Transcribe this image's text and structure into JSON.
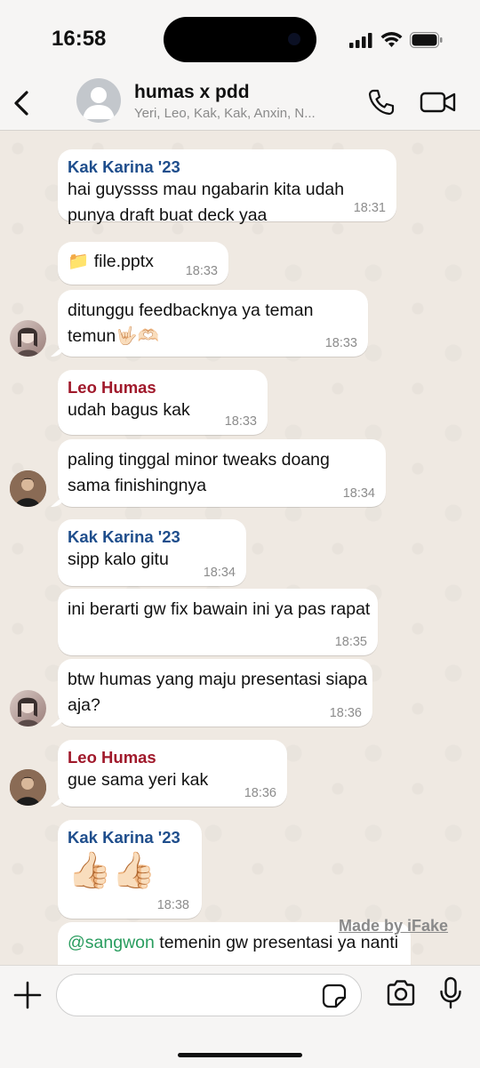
{
  "status_bar": {
    "time": "16:58"
  },
  "header": {
    "title": "humas x pdd",
    "subtitle": "Yeri, Leo, Kak, Kak, Anxin, N..."
  },
  "messages": [
    {
      "sender": "Kak Karina '23",
      "text": "hai guyssss mau ngabarin kita udah punya draft buat deck yaa",
      "time": "18:31"
    },
    {
      "sender": "",
      "text": "📁 file.pptx",
      "time": "18:33"
    },
    {
      "sender": "",
      "text": "ditunggu feedbacknya ya teman temun🤟🏻🫶🏻",
      "time": "18:33"
    },
    {
      "sender": "Leo Humas",
      "text": "udah bagus kak",
      "time": "18:33"
    },
    {
      "sender": "",
      "text": "paling tinggal minor tweaks doang sama finishingnya",
      "time": "18:34"
    },
    {
      "sender": "Kak Karina '23",
      "text": "sipp kalo gitu",
      "time": "18:34"
    },
    {
      "sender": "",
      "text": "ini berarti gw fix bawain ini ya pas rapat",
      "time": "18:35"
    },
    {
      "sender": "",
      "text": "btw humas yang maju presentasi siapa aja?",
      "time": "18:36"
    },
    {
      "sender": "Leo Humas",
      "text": "gue sama yeri kak",
      "time": "18:36"
    },
    {
      "sender": "Kak Karina '23",
      "text": "👍🏻👍🏻",
      "time": "18:38"
    },
    {
      "mention": "@sangwon",
      "text": " temenin gw presentasi ya nanti"
    }
  ],
  "watermark": "Made by iFake",
  "composer": {
    "placeholder": ""
  }
}
